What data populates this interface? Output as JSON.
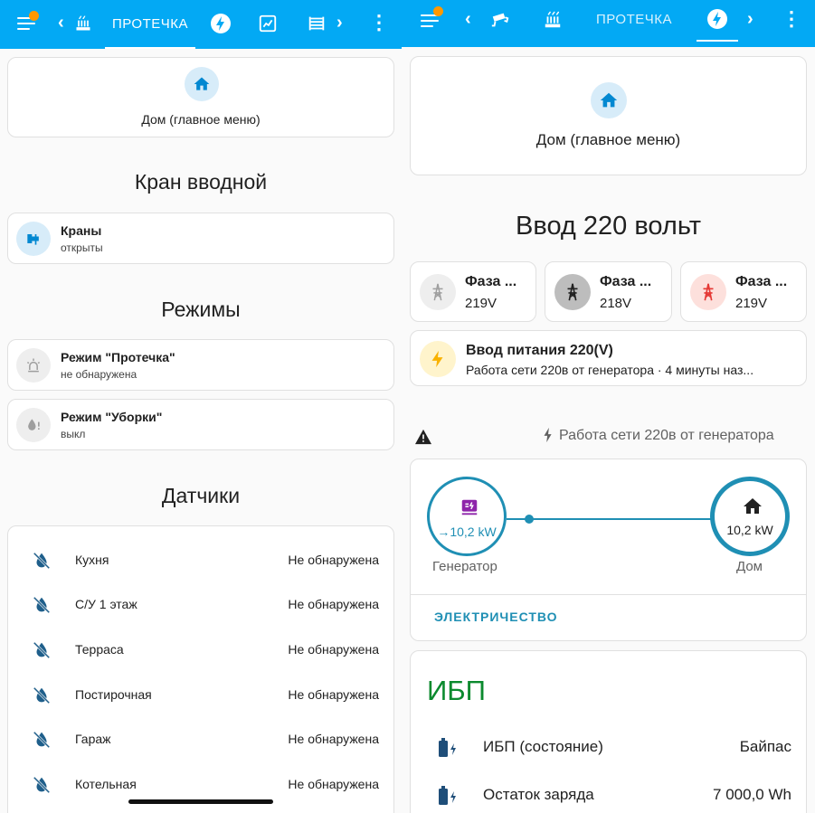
{
  "left": {
    "topbar": {
      "active_tab": "ПРОТЕЧКА"
    },
    "home_card": {
      "label": "Дом (главное меню)"
    },
    "section_valve": {
      "title": "Кран вводной"
    },
    "valves": {
      "name": "Краны",
      "state": "открыты"
    },
    "section_modes": {
      "title": "Режимы"
    },
    "modes": [
      {
        "name": "Режим \"Протечка\"",
        "state": "не обнаружена"
      },
      {
        "name": "Режим \"Уборки\"",
        "state": "выкл"
      }
    ],
    "section_sensors": {
      "title": "Датчики"
    },
    "sensors": [
      {
        "name": "Кухня",
        "value": "Не обнаружена"
      },
      {
        "name": "С/У 1 этаж",
        "value": "Не обнаружена"
      },
      {
        "name": "Терраса",
        "value": "Не обнаружена"
      },
      {
        "name": "Постирочная",
        "value": "Не обнаружена"
      },
      {
        "name": "Гараж",
        "value": "Не обнаружена"
      },
      {
        "name": "Котельная",
        "value": "Не обнаружена"
      }
    ]
  },
  "right": {
    "topbar": {
      "active_tab": "ПРОТЕЧКА"
    },
    "home_card": {
      "label": "Дом (главное меню)"
    },
    "section_input": {
      "title": "Ввод 220 вольт"
    },
    "phases": [
      {
        "name": "Фаза ...",
        "value": "219V",
        "color": "#9e9e9e",
        "bg": "#eeeeee"
      },
      {
        "name": "Фаза ...",
        "value": "218V",
        "color": "#212121",
        "bg": "#bdbdbd"
      },
      {
        "name": "Фаза ...",
        "value": "219V",
        "color": "#e53935",
        "bg": "#fde0dc"
      }
    ],
    "power_input": {
      "name": "Ввод питания 220(V)",
      "state": "Работа сети 220в от генератора · 4 минуты наз..."
    },
    "status_line": {
      "text": "Работа сети 220в от генератора"
    },
    "energy": {
      "generator_value": "→10,2 kW",
      "generator_label": "Генератор",
      "home_value": "10,2 kW",
      "home_label": "Дом",
      "link": "ЭЛЕКТРИЧЕСТВО",
      "accent": "#1f8fb4"
    },
    "ups": {
      "title": "ИБП",
      "title_color": "#0b8a2e",
      "rows": [
        {
          "name": "ИБП (состояние)",
          "value": "Байпас"
        },
        {
          "name": "Остаток заряда",
          "value": "7 000,0 Wh"
        }
      ]
    }
  }
}
